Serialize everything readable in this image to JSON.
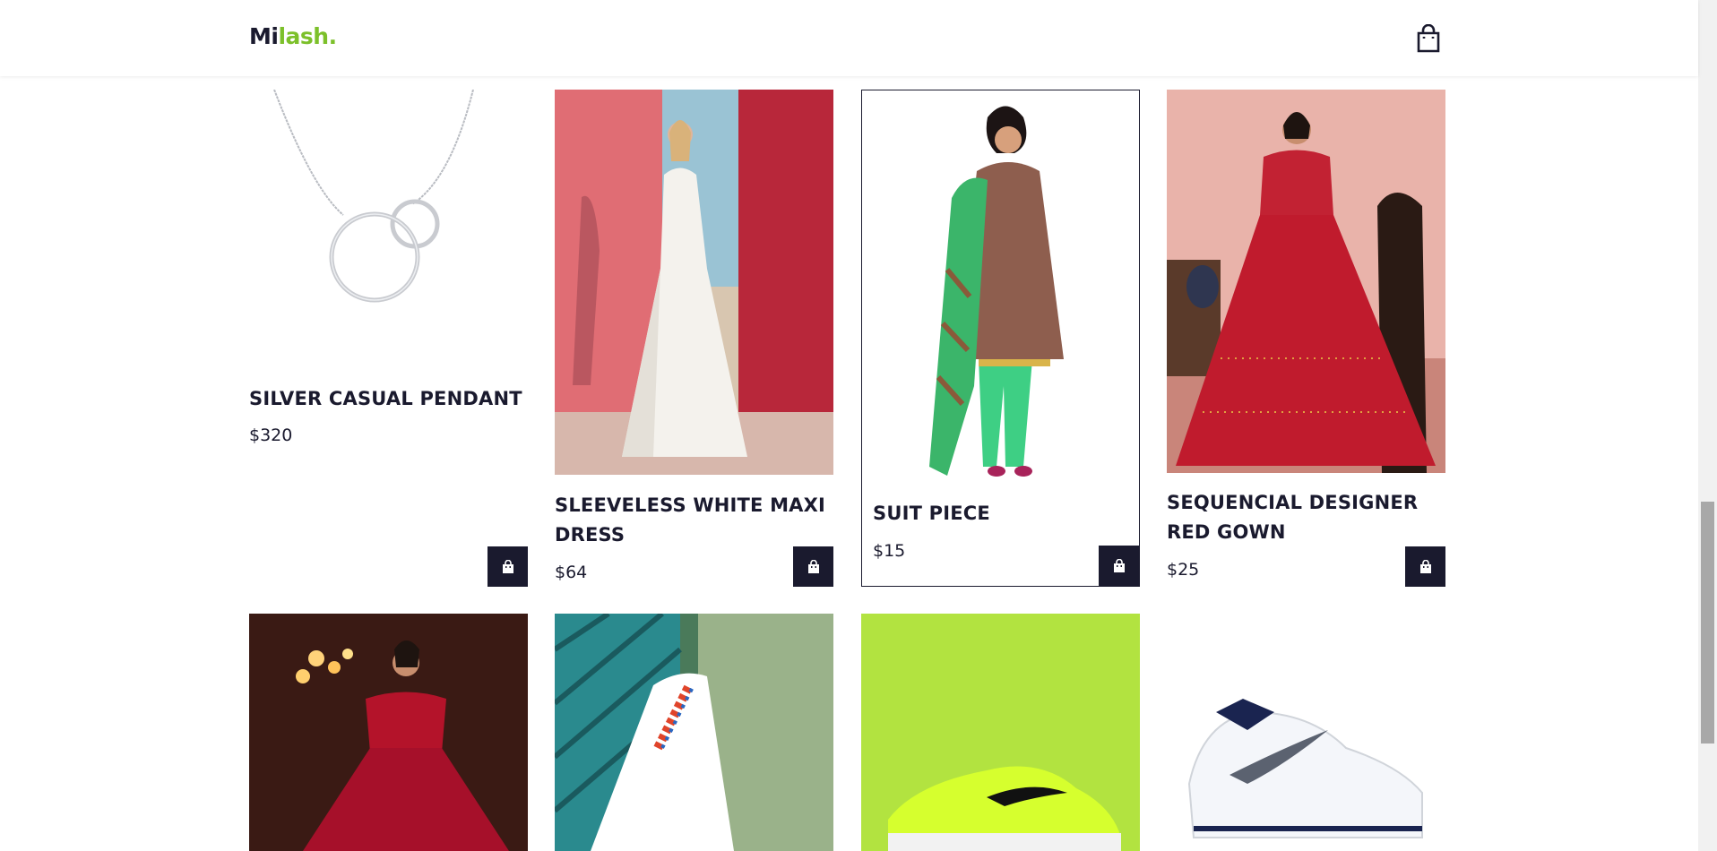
{
  "brand": {
    "part1": "Mi",
    "part2": "lash."
  },
  "colors": {
    "dark": "#1a1a2e",
    "accent": "#7cc02a"
  },
  "icons": {
    "cart": "shopping-bag-icon"
  },
  "products": [
    {
      "name": "SILVER CASUAL PENDANT",
      "price": "$320",
      "image": "silver-pendant-image"
    },
    {
      "name": "SLEEVELESS WHITE MAXI DRESS",
      "price": "$64",
      "image": "white-maxi-dress-image"
    },
    {
      "name": "SUIT PIECE",
      "price": "$15",
      "image": "suit-piece-image"
    },
    {
      "name": "SEQUENCIAL DESIGNER RED GOWN",
      "price": "$25",
      "image": "red-gown-image"
    },
    {
      "image": "red-bridal-gown-image"
    },
    {
      "image": "sneaker-colorful-image"
    },
    {
      "image": "green-sneaker-image"
    },
    {
      "image": "white-nike-sneaker-image"
    }
  ]
}
